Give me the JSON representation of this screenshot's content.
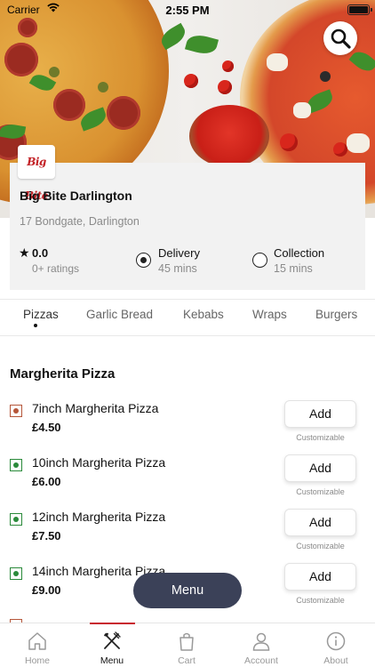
{
  "status_bar": {
    "carrier": "Carrier",
    "time": "2:55 PM"
  },
  "restaurant": {
    "logo_text": "Big Bite",
    "name": "Big Bite Darlington",
    "address": "17 Bondgate, Darlington",
    "rating": "0.0",
    "rating_count": "0+ ratings",
    "delivery": {
      "label": "Delivery",
      "time": "45 mins",
      "selected": true
    },
    "collection": {
      "label": "Collection",
      "time": "15 mins",
      "selected": false
    }
  },
  "categories": [
    "Pizzas",
    "Garlic Bread",
    "Kebabs",
    "Wraps",
    "Burgers"
  ],
  "active_category": "Pizzas",
  "section_title": "Margherita Pizza",
  "items": [
    {
      "name": "7inch Margherita Pizza",
      "price": "£4.50",
      "type": "nonveg",
      "button": "Add",
      "note": "Customizable"
    },
    {
      "name": "10inch Margherita Pizza",
      "price": "£6.00",
      "type": "veg",
      "button": "Add",
      "note": "Customizable"
    },
    {
      "name": "12inch Margherita Pizza",
      "price": "£7.50",
      "type": "veg",
      "button": "Add",
      "note": "Customizable"
    },
    {
      "name": "14inch Margherita Pizza",
      "price": "£9.00",
      "type": "veg",
      "button": "Add",
      "note": "Customizable"
    }
  ],
  "menu_button": "Menu",
  "nav": [
    {
      "label": "Home",
      "icon": "home-icon",
      "active": false
    },
    {
      "label": "Menu",
      "icon": "fork-knife-icon",
      "active": true
    },
    {
      "label": "Cart",
      "icon": "bag-icon",
      "active": false
    },
    {
      "label": "Account",
      "icon": "person-icon",
      "active": false
    },
    {
      "label": "About",
      "icon": "info-icon",
      "active": false
    }
  ],
  "colors": {
    "accent": "#c8202e",
    "fab": "#3b4158",
    "veg": "#2a8a3a",
    "nonveg": "#b5563a"
  }
}
